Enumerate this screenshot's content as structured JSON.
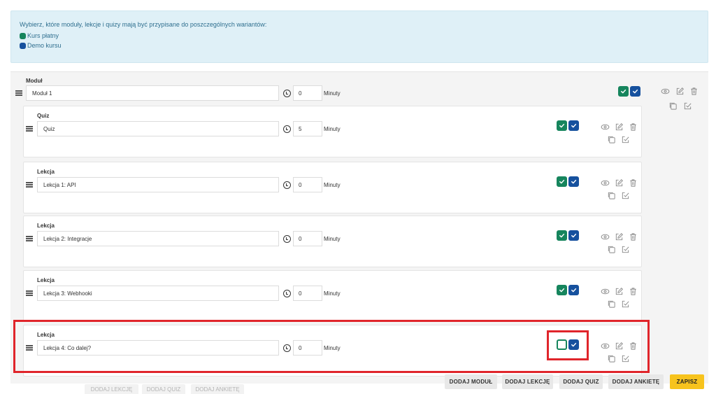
{
  "info": {
    "message": "Wybierz, które moduły, lekcje i quizy mają być przypisane do poszczególnych wariantów:",
    "variants": [
      {
        "label": "Kurs płatny",
        "color": "#16855d"
      },
      {
        "label": "Demo kursu",
        "color": "#16519e"
      }
    ]
  },
  "module": {
    "label": "Moduł",
    "title": "Moduł 1",
    "minutes": "0",
    "unit": "Minuty",
    "variant_paid_checked": true,
    "variant_demo_checked": true
  },
  "items": [
    {
      "label": "Quiz",
      "title": "Quiz",
      "minutes": "5",
      "unit": "Minuty",
      "paid_checked": true,
      "demo_checked": true
    },
    {
      "label": "Lekcja",
      "title": "Lekcja 1: API",
      "minutes": "0",
      "unit": "Minuty",
      "paid_checked": true,
      "demo_checked": true
    },
    {
      "label": "Lekcja",
      "title": "Lekcja 2: Integracje",
      "minutes": "0",
      "unit": "Minuty",
      "paid_checked": true,
      "demo_checked": true
    },
    {
      "label": "Lekcja",
      "title": "Lekcja 3: Webhooki",
      "minutes": "0",
      "unit": "Minuty",
      "paid_checked": true,
      "demo_checked": true
    },
    {
      "label": "Lekcja",
      "title": "Lekcja 4: Co dalej?",
      "minutes": "0",
      "unit": "Minuty",
      "paid_checked": false,
      "demo_checked": true
    }
  ],
  "module_footer": {
    "add_lesson": "DODAJ LEKCJĘ",
    "add_quiz": "DODAJ QUIZ",
    "add_survey": "DODAJ ANKIETĘ"
  },
  "toolbar": {
    "add_module": "DODAJ MODUŁ",
    "add_lesson": "DODAJ LEKCJĘ",
    "add_quiz": "DODAJ QUIZ",
    "add_survey": "DODAJ ANKIETĘ",
    "save": "ZAPISZ"
  },
  "colors": {
    "paid": "#16855d",
    "demo": "#16519e",
    "highlight": "#e0252b",
    "save_button": "#f7c31d"
  }
}
